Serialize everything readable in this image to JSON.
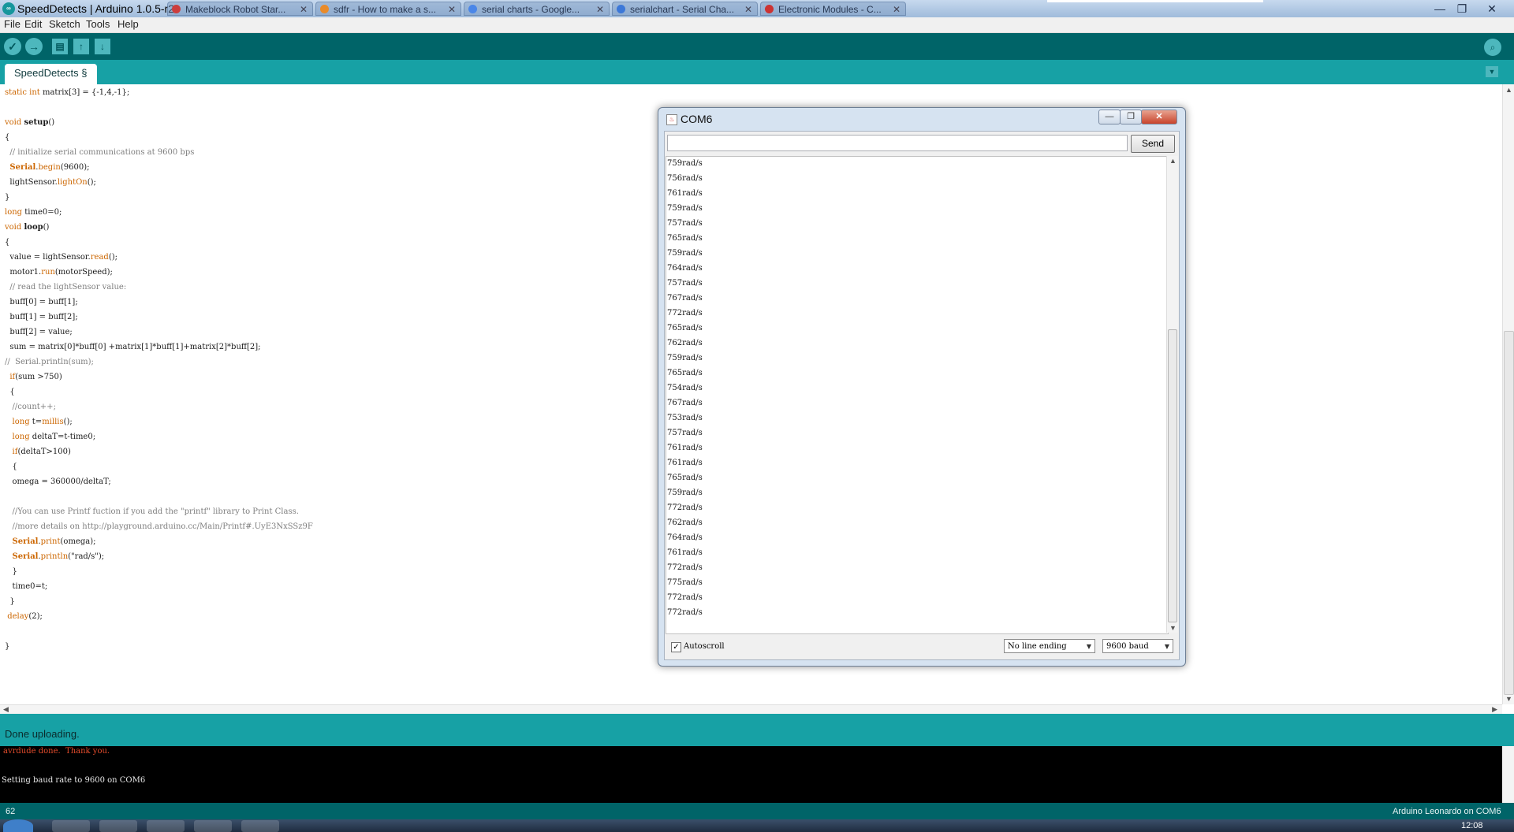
{
  "window": {
    "title": "SpeedDetects | Arduino 1.0.5-r2",
    "app_icon_text": "∞",
    "browser_tabs": [
      {
        "label": "Makeblock Robot Star...",
        "color": "#cc3d3d"
      },
      {
        "label": "sdfr - How to make a s...",
        "color": "#e98b2a"
      },
      {
        "label": "serial charts - Google...",
        "color": "#4a86e8"
      },
      {
        "label": "serialchart - Serial Cha...",
        "color": "#3c78d8"
      },
      {
        "label": "Electronic Modules - C...",
        "color": "#cc3333"
      }
    ],
    "controls": {
      "minimize": "—",
      "maximize": "❐",
      "close": "✕"
    }
  },
  "menu": [
    "File",
    "Edit",
    "Sketch",
    "Tools",
    "Help"
  ],
  "toolbar": {
    "verify_icon": "✓",
    "upload_icon": "→",
    "new_icon": "▤",
    "open_icon": "↑",
    "save_icon": "↓",
    "serial_monitor_icon": "⌕"
  },
  "tab": {
    "label": "SpeedDetects §",
    "menu_icon": "▼"
  },
  "code_lines": [
    "static int matrix[3] = {-1,4,-1};",
    "",
    "void setup()",
    "{",
    "  // initialize serial communications at 9600 bps",
    "  Serial.begin(9600);",
    "  lightSensor.lightOn();",
    "}",
    "long time0=0;",
    "void loop()",
    "{",
    "  value = lightSensor.read();",
    "  motor1.run(motorSpeed);",
    "  // read the lightSensor value:",
    "  buff[0] = buff[1];",
    "  buff[1] = buff[2];",
    "  buff[2] = value;",
    "  sum = matrix[0]*buff[0] +matrix[1]*buff[1]+matrix[2]*buff[2];",
    "//  Serial.println(sum);",
    "  if(sum >750)",
    "  {",
    "   //count++;",
    "   long t=millis();",
    "   long deltaT=t-time0;",
    "   if(deltaT>100)",
    "   {",
    "   omega = 360000/deltaT;",
    "",
    "   //You can use Printf fuction if you add the \"printf\" library to Print Class.",
    "   //more details on http://playground.arduino.cc/Main/Printf#.UyE3NxSSz9F",
    "   Serial.print(omega);",
    "   Serial.println(\"rad/s\");",
    "   }",
    "   time0=t;",
    "  }",
    " delay(2);",
    "",
    "}"
  ],
  "status": {
    "message": "Done uploading."
  },
  "console": {
    "error_line": "avrdude done.  Thank you.",
    "output_line": "Setting baud rate to 9600 on COM6"
  },
  "footer": {
    "line_number": "62",
    "board": "Arduino Leonardo on COM6"
  },
  "taskbar": {
    "clock": "12:08"
  },
  "serial_monitor": {
    "title": "COM6",
    "input_value": "",
    "send_label": "Send",
    "output": [
      "759rad/s",
      "756rad/s",
      "761rad/s",
      "759rad/s",
      "757rad/s",
      "765rad/s",
      "759rad/s",
      "764rad/s",
      "757rad/s",
      "767rad/s",
      "772rad/s",
      "765rad/s",
      "762rad/s",
      "759rad/s",
      "765rad/s",
      "754rad/s",
      "767rad/s",
      "753rad/s",
      "757rad/s",
      "761rad/s",
      "761rad/s",
      "765rad/s",
      "759rad/s",
      "772rad/s",
      "762rad/s",
      "764rad/s",
      "761rad/s",
      "772rad/s",
      "775rad/s",
      "772rad/s",
      "772rad/s"
    ],
    "autoscroll_label": "Autoscroll",
    "autoscroll_checked": true,
    "line_ending": "No line ending",
    "baud": "9600 baud"
  }
}
